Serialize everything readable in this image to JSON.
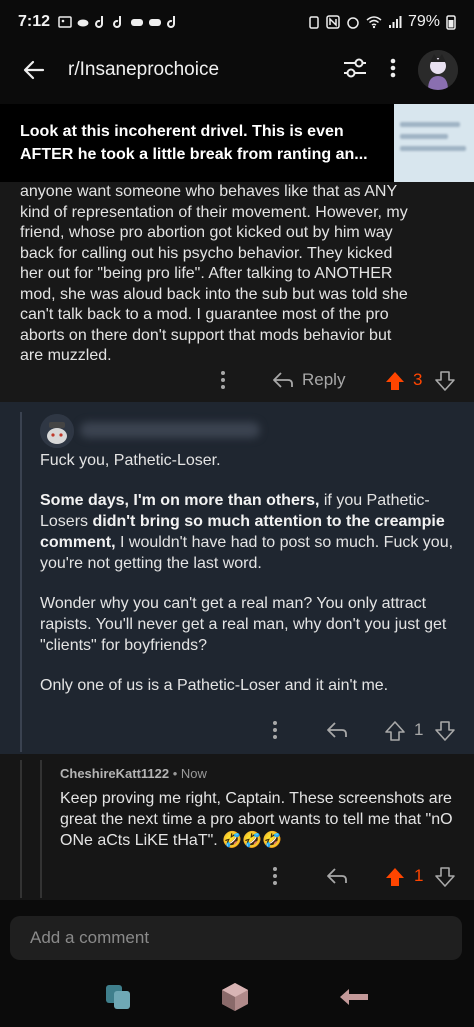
{
  "status_bar": {
    "time": "7:12",
    "battery": "79%"
  },
  "header": {
    "title": "r/Insaneprochoice"
  },
  "post": {
    "title": "Look at this incoherent drivel. This is even AFTER he took a little break from ranting an..."
  },
  "comment1": {
    "body": "anyone want someone who behaves like that as ANY\nkind of representation of their movement. However, my\nfriend, whose pro abortion got kicked out by him way\nback for calling out his psycho behavior. They kicked\nher out for \"being pro life\". After talking to ANOTHER\nmod, she was aloud back into the sub but was told she\ncan't talk back to a mod. I guarantee most of the pro\naborts on there don't support that mods behavior but\nare muzzled.",
    "reply_label": "Reply",
    "votes": "3",
    "upvoted": true
  },
  "comment2": {
    "p1": "Fuck you, Pathetic-Loser.",
    "p2_bold1": "Some days, I'm on more than others,",
    "p2_text1": " if you Pathetic-Losers ",
    "p2_bold2": "didn't bring so much attention to the creampie comment,",
    "p2_text2": " I wouldn't have had to post so much. Fuck you, you're not getting the last word.",
    "p3": "Wonder why you can't get a real man? You only attract rapists. You'll never get a real man, why don't you just get \"clients\" for boyfriends?",
    "p4": "Only one of us is a Pathetic-Loser and it ain't me.",
    "votes": "1"
  },
  "comment3": {
    "username": "CheshireKatt1122",
    "time": "• Now",
    "body": "Keep proving me right, Captain. These screenshots are great the next time a pro abort wants to tell me that \"nO ONe aCts LiKE tHaT\". 🤣🤣🤣",
    "votes": "1",
    "upvoted": true
  },
  "input": {
    "placeholder": "Add a comment"
  },
  "colors": {
    "upvote": "#ff4500",
    "background": "#0b0b0b",
    "nested_bg": "#1f2630"
  }
}
